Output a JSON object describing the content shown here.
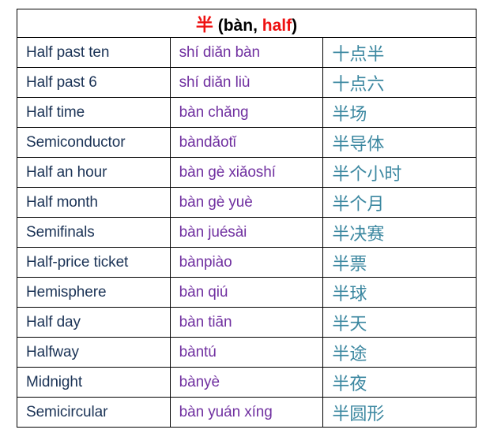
{
  "document": {
    "title_parts": {
      "character": "半",
      "open": " (bàn, ",
      "meaning": "half",
      "close": ")"
    },
    "colors": {
      "accent_red": "#ee1111",
      "english_navy": "#1b3356",
      "pinyin_purple": "#7030a0",
      "hanzi_teal": "#3b87a0",
      "border": "#000000"
    }
  },
  "table": {
    "rows": [
      {
        "english": "Half past ten",
        "pinyin": "shí diǎn bàn",
        "hanzi": "十点半"
      },
      {
        "english": "Half past 6",
        "pinyin": "shí diǎn liù",
        "hanzi": "十点六"
      },
      {
        "english": "Half time",
        "pinyin": "bàn chǎng",
        "hanzi": "半场"
      },
      {
        "english": "Semiconductor",
        "pinyin": "bàndǎotǐ",
        "hanzi": "半导体"
      },
      {
        "english": "Half an hour",
        "pinyin": "bàn gè xiǎoshí",
        "hanzi": "半个小时"
      },
      {
        "english": "Half month",
        "pinyin": "bàn gè yuè",
        "hanzi": "半个月"
      },
      {
        "english": "Semifinals",
        "pinyin": "bàn juésài",
        "hanzi": "半决赛"
      },
      {
        "english": "Half-price ticket",
        "pinyin": "bànpiào",
        "hanzi": "半票"
      },
      {
        "english": "Hemisphere",
        "pinyin": "bàn qiú",
        "hanzi": "半球"
      },
      {
        "english": "Half day",
        "pinyin": "bàn tiān",
        "hanzi": "半天"
      },
      {
        "english": "Halfway",
        "pinyin": "bàntú",
        "hanzi": "半途"
      },
      {
        "english": "Midnight",
        "pinyin": "bànyè",
        "hanzi": "半夜"
      },
      {
        "english": "Semicircular",
        "pinyin": "bàn yuán xíng",
        "hanzi": "半圆形"
      }
    ]
  }
}
